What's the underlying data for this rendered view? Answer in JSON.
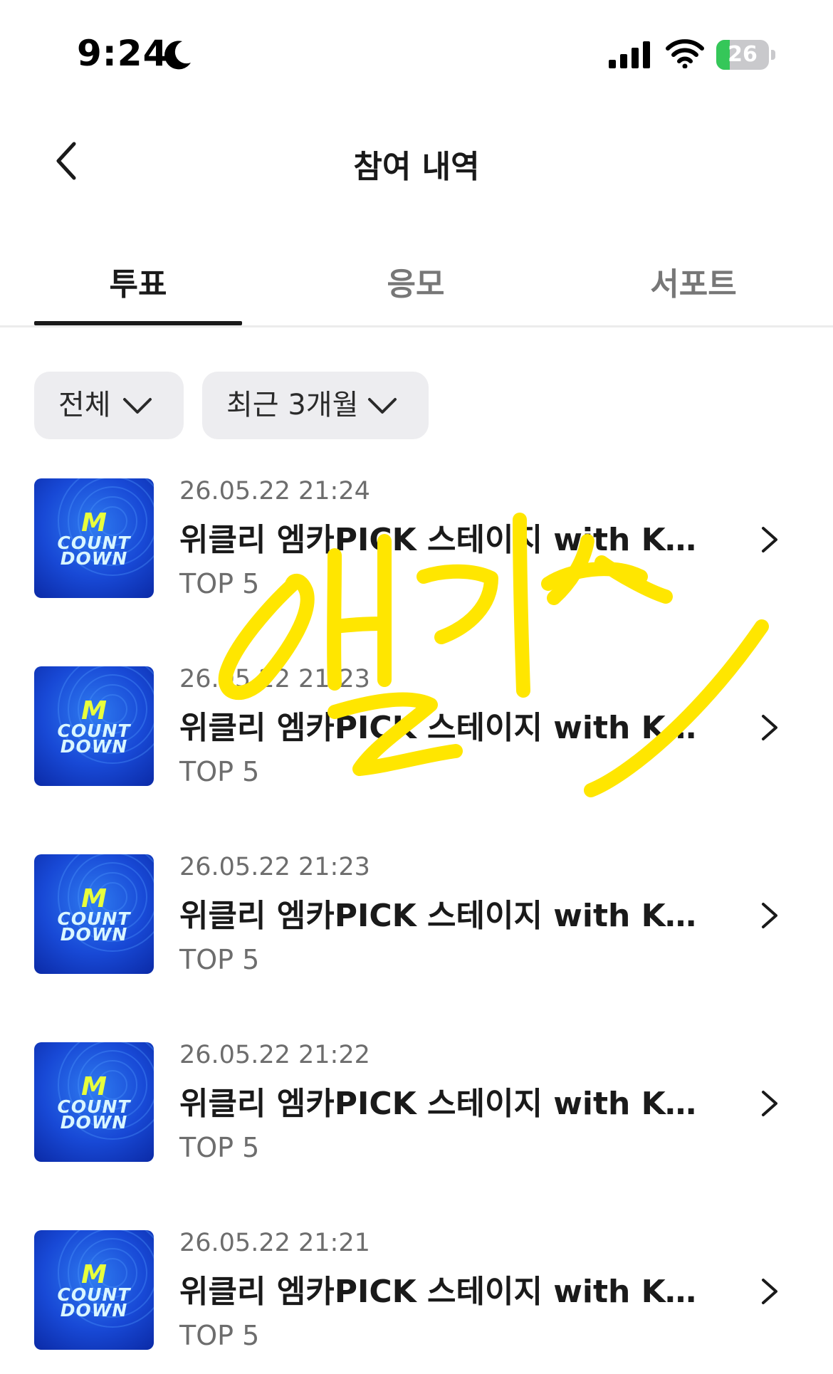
{
  "status_bar": {
    "time": "9:24",
    "battery_level": "26",
    "battery_fraction": 0.26,
    "icons": [
      "moon-icon",
      "signal-icon",
      "wifi-icon",
      "battery-icon"
    ]
  },
  "header": {
    "title": "참여 내역",
    "back_icon": "chevron-left-icon"
  },
  "tabs": [
    {
      "label": "투표",
      "active": true
    },
    {
      "label": "응모",
      "active": false
    },
    {
      "label": "서포트",
      "active": false
    }
  ],
  "filters": [
    {
      "label": "전체",
      "icon": "chevron-down-icon"
    },
    {
      "label": "최근 3개월",
      "icon": "chevron-down-icon"
    }
  ],
  "items": [
    {
      "date": "26.05.22 21:24",
      "title": "위클리 엠카PICK 스테이지 with KU...",
      "subtitle": "TOP 5",
      "thumb_m": "M",
      "thumb_line1": "COUNT",
      "thumb_line2": "DOWN"
    },
    {
      "date": "26.05.22 21:23",
      "title": "위클리 엠카PICK 스테이지 with KU...",
      "subtitle": "TOP 5",
      "thumb_m": "M",
      "thumb_line1": "COUNT",
      "thumb_line2": "DOWN"
    },
    {
      "date": "26.05.22 21:23",
      "title": "위클리 엠카PICK 스테이지 with KU...",
      "subtitle": "TOP 5",
      "thumb_m": "M",
      "thumb_line1": "COUNT",
      "thumb_line2": "DOWN"
    },
    {
      "date": "26.05.22 21:22",
      "title": "위클리 엠카PICK 스테이지 with KU...",
      "subtitle": "TOP 5",
      "thumb_m": "M",
      "thumb_line1": "COUNT",
      "thumb_line2": "DOWN"
    },
    {
      "date": "26.05.22 21:21",
      "title": "위클리 엠카PICK 스테이지 with KU...",
      "subtitle": "TOP 5",
      "thumb_m": "M",
      "thumb_line1": "COUNT",
      "thumb_line2": "DOWN"
    }
  ],
  "colors": {
    "text_primary": "#1a1a1a",
    "text_secondary": "#6d6d6d",
    "chip_bg": "#ededf0",
    "battery_green": "#35c759",
    "scribble_yellow": "#ffe600"
  }
}
